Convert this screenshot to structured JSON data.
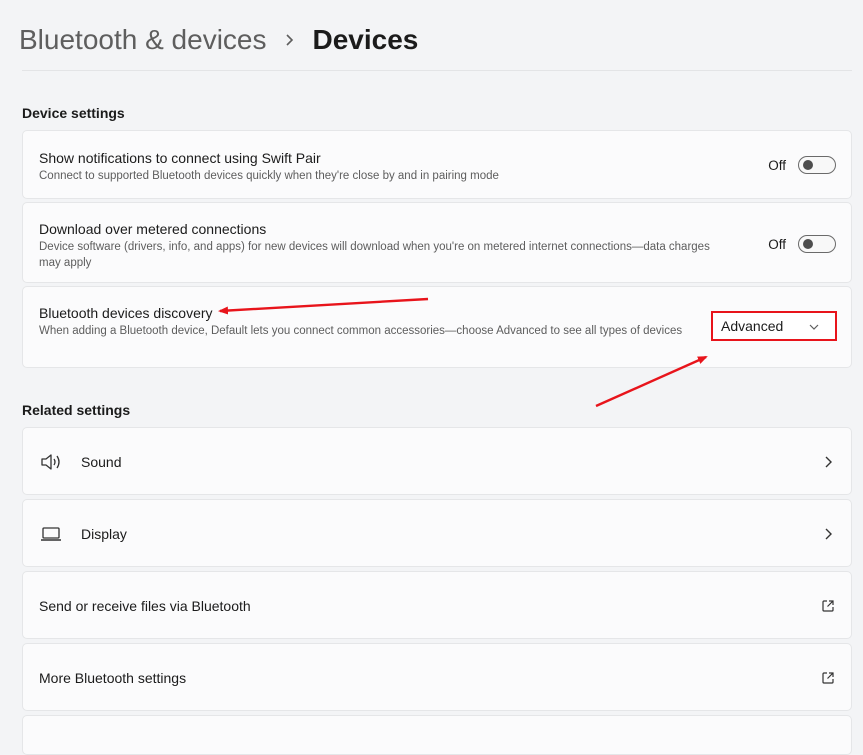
{
  "breadcrumb": {
    "parent": "Bluetooth & devices",
    "separator_icon": "chevron-right-icon",
    "current": "Devices"
  },
  "device_settings": {
    "title": "Device settings",
    "swift_pair": {
      "title": "Show notifications to connect using Swift Pair",
      "description": "Connect to supported Bluetooth devices quickly when they're close by and in pairing mode",
      "state_label": "Off",
      "enabled": false
    },
    "metered": {
      "title": "Download over metered connections",
      "description": "Device software (drivers, info, and apps) for new devices will download when you're on metered internet connections—data charges may apply",
      "state_label": "Off",
      "enabled": false
    },
    "discovery": {
      "title": "Bluetooth devices discovery",
      "description": "When adding a Bluetooth device, Default lets you connect common accessories—choose Advanced to see all types of devices",
      "selected_value": "Advanced",
      "highlight_color": "#e8141b"
    }
  },
  "related_settings": {
    "title": "Related settings",
    "items": [
      {
        "label": "Sound",
        "icon": "speaker-icon",
        "action_icon": "chevron-right-icon"
      },
      {
        "label": "Display",
        "icon": "laptop-icon",
        "action_icon": "chevron-right-icon"
      },
      {
        "label": "Send or receive files via Bluetooth",
        "icon": "",
        "action_icon": "external-link-icon"
      },
      {
        "label": "More Bluetooth settings",
        "icon": "",
        "action_icon": "external-link-icon"
      }
    ]
  },
  "annotations": {
    "arrow_color": "#e8141b"
  }
}
